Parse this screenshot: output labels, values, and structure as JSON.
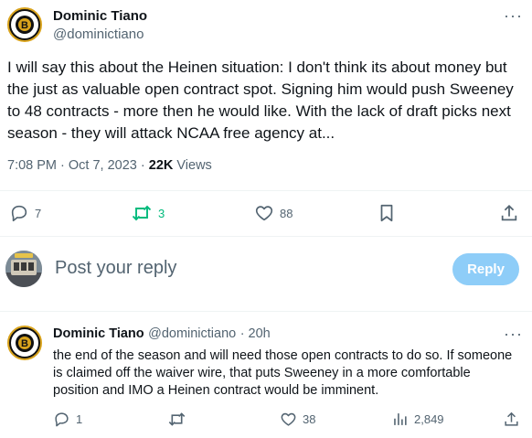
{
  "main_tweet": {
    "author_name": "Dominic Tiano",
    "author_handle": "@dominictiano",
    "more_icon": "···",
    "text": "I will say this about the Heinen situation: I don't think its about money but the just as valuable open contract spot. Signing him would push Sweeney to 48 contracts - more then he would like. With the lack of draft picks next season - they will attack NCAA free agency at...",
    "timestamp": "7:08 PM · Oct 7, 2023 · ",
    "views_count": "22K",
    "views_label": " Views",
    "actions": {
      "reply_count": "7",
      "retweet_count": "3",
      "like_count": "88"
    },
    "retweet_color": "#00ba7c"
  },
  "compose": {
    "placeholder": "Post your reply",
    "button_label": "Reply",
    "button_color": "#8ecdf8"
  },
  "reply_tweet": {
    "author_name": "Dominic Tiano",
    "author_handle": "@dominictiano",
    "time": "· 20h",
    "more_icon": "···",
    "text": "the end of the season and will need those open contracts to do so. If someone is claimed off the waiver wire, that puts Sweeney in a more comfortable position and IMO a Heinen contract would be imminent.",
    "actions": {
      "reply_count": "1",
      "like_count": "38",
      "views_count": "2,849"
    }
  },
  "icons": [
    "bruins-logo-avatar",
    "more-icon",
    "reply-icon",
    "retweet-icon",
    "like-icon",
    "bookmark-icon",
    "share-icon",
    "views-icon"
  ]
}
